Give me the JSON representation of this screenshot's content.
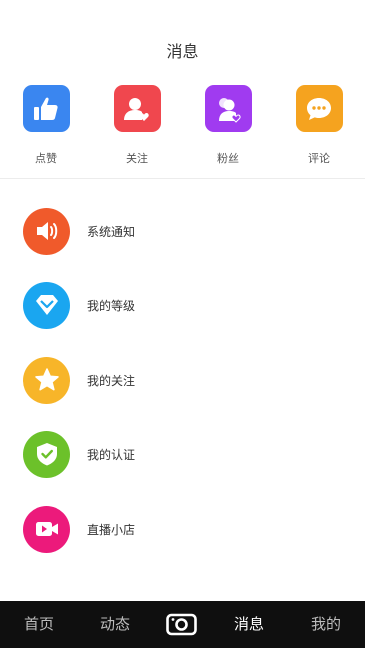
{
  "header": {
    "title": "消息"
  },
  "top_shortcuts": [
    {
      "label": "点赞",
      "icon": "thumbs-up-icon",
      "color": "#3a86f0"
    },
    {
      "label": "关注",
      "icon": "user-heart-icon",
      "color": "#f0474e"
    },
    {
      "label": "粉丝",
      "icon": "fans-icon",
      "color": "#a03bf0"
    },
    {
      "label": "评论",
      "icon": "comment-icon",
      "color": "#f5a31f"
    }
  ],
  "list": [
    {
      "label": "系统通知",
      "icon": "speaker-icon",
      "color": "#f05a2b"
    },
    {
      "label": "我的等级",
      "icon": "diamond-icon",
      "color": "#1aa6f0"
    },
    {
      "label": "我的关注",
      "icon": "star-icon",
      "color": "#f7b529"
    },
    {
      "label": "我的认证",
      "icon": "shield-check-icon",
      "color": "#6cc12a"
    },
    {
      "label": "直播小店",
      "icon": "video-icon",
      "color": "#ec1a7b"
    }
  ],
  "tabbar": {
    "tabs": [
      {
        "label": "首页"
      },
      {
        "label": "动态"
      },
      {
        "label": "消息"
      },
      {
        "label": "我的"
      }
    ],
    "active": "消息",
    "camera_icon": "camera-icon"
  }
}
